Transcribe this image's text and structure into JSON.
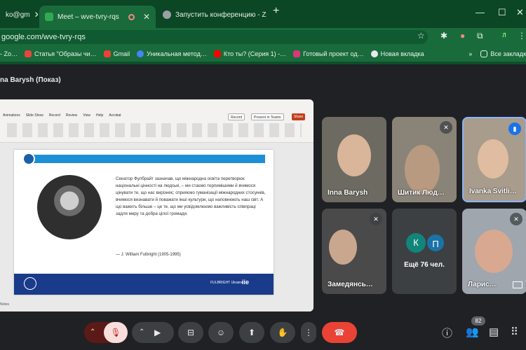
{
  "tabs": [
    {
      "label": "ko@gm",
      "x": 0
    },
    {
      "label": "Meet – wve-tvry-rqs"
    },
    {
      "label": "Запустить конференцию - Zoo"
    }
  ],
  "url": "google.com/wve-tvry-rqs",
  "bookmarks": [
    "- Zo…",
    "Статья \"Образы чи…",
    "Gmail",
    "Уникальная метод…",
    "Кто ты? (Серия 1) -…",
    "Готовый проект од…",
    "Новая вкладка",
    "Все закладк"
  ],
  "meeting": {
    "presenting_title": "na Barysh (Показ)"
  },
  "slide": {
    "ribbon_menu": [
      "Slide Show",
      "Record",
      "Review",
      "View",
      "Help",
      "Acrobat"
    ],
    "ribbon_first": "Animations",
    "record_label": "Record",
    "present_label": "Present in Teams",
    "share_label": "Share",
    "quote": "Сенатор Фулбрайт зазначав, що міжнародна освіта перетворює національні цінності на людські, – ми стаємо терпимішими й вчимося цінувати те, що нас вирізняє; сприяємо гуманізації міжнародних стосунків, вчимося визнавати й поважати інші культури, що наповнюють наш світ. А що важить більше – це те, що ми усвідомлюємо важливість співпраці задля миру та добра цілої громади.",
    "author": "— J. William Fulbright (1905-1995)",
    "footer_left": "FULBRIGHT Ukraine",
    "footer_right": "iie",
    "notes_label": "Notes"
  },
  "participants": [
    {
      "name": "Inna Barysh",
      "muted": false,
      "bg": "#6d6a62"
    },
    {
      "name": "Шитик Люд…",
      "muted": true,
      "bg": "#8a8478"
    },
    {
      "name": "Ivanka Svitli…",
      "muted": false,
      "bg": "#a89c8c"
    },
    {
      "name": "Замедянсь…",
      "muted": true,
      "bg": "#4a4a4a"
    },
    {
      "name": "Ларис…",
      "muted": true,
      "bg": "#9fa6ae"
    }
  ],
  "more": {
    "avatars": [
      {
        "letter": "К",
        "color": "#12857a"
      },
      {
        "letter": "П",
        "color": "#1a73a8"
      }
    ],
    "label": "Ещё 76 чел."
  },
  "controls": {
    "people_count": "82"
  },
  "icons": {
    "mic_off": "mic-off-icon",
    "camera": "camera-icon",
    "captions": "captions-icon",
    "emoji": "emoji-icon",
    "present": "present-icon",
    "raise_hand": "raise-hand-icon",
    "more": "more-options-icon",
    "hangup": "hangup-icon",
    "info": "info-icon",
    "people": "people-icon",
    "chat": "chat-icon",
    "activities": "activities-icon"
  },
  "colors": {
    "chrome_green": "#0d4f2a",
    "meet_bg": "#202124",
    "hangup_red": "#ea4335"
  }
}
